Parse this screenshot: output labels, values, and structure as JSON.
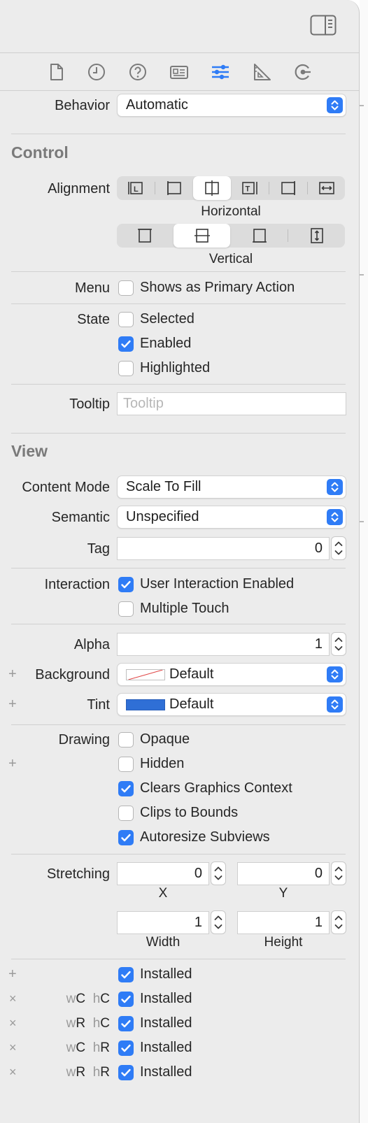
{
  "tabs": [
    {
      "name": "file-inspector",
      "icon": "document-icon",
      "active": false
    },
    {
      "name": "history-inspector",
      "icon": "clock-icon",
      "active": false
    },
    {
      "name": "quick-help",
      "icon": "question-icon",
      "active": false
    },
    {
      "name": "identity-inspector",
      "icon": "id-card-icon",
      "active": false
    },
    {
      "name": "attributes-inspector",
      "icon": "sliders-icon",
      "active": true
    },
    {
      "name": "size-inspector",
      "icon": "ruler-icon",
      "active": false
    },
    {
      "name": "connections-inspector",
      "icon": "arrow-circle-icon",
      "active": false
    }
  ],
  "accent_color": "#2F7CF6",
  "behavior": {
    "label": "Behavior",
    "value": "Automatic"
  },
  "control": {
    "title": "Control",
    "alignment_label": "Alignment",
    "horizontal_caption": "Horizontal",
    "vertical_caption": "Vertical",
    "horizontal_selected_index": 2,
    "vertical_selected_index": 1,
    "menu_label": "Menu",
    "menu_option": "Shows as Primary Action",
    "state_label": "State",
    "state_selected": "Selected",
    "state_enabled": "Enabled",
    "state_highlighted": "Highlighted",
    "tooltip_label": "Tooltip",
    "tooltip_placeholder": "Tooltip"
  },
  "view": {
    "title": "View",
    "content_mode_label": "Content Mode",
    "content_mode_value": "Scale To Fill",
    "semantic_label": "Semantic",
    "semantic_value": "Unspecified",
    "tag_label": "Tag",
    "tag_value": "0",
    "interaction_label": "Interaction",
    "user_interaction": "User Interaction Enabled",
    "multiple_touch": "Multiple Touch",
    "alpha_label": "Alpha",
    "alpha_value": "1",
    "background_label": "Background",
    "background_value": "Default",
    "tint_label": "Tint",
    "tint_value": "Default",
    "tint_color": "#2F6FD6",
    "drawing_label": "Drawing",
    "opaque": "Opaque",
    "hidden": "Hidden",
    "clears_graphics": "Clears Graphics Context",
    "clips_bounds": "Clips to Bounds",
    "autoresize": "Autoresize Subviews",
    "stretching_label": "Stretching",
    "stretch_x": "0",
    "stretch_y": "0",
    "stretch_width": "1",
    "stretch_height": "1",
    "x_caption": "X",
    "y_caption": "Y",
    "width_caption": "Width",
    "height_caption": "Height"
  },
  "installed": {
    "label": "Installed",
    "rows": [
      {
        "action": "+",
        "w": "",
        "wv": "",
        "h": "",
        "hv": ""
      },
      {
        "action": "×",
        "w": "w",
        "wv": "C",
        "h": "h",
        "hv": "C"
      },
      {
        "action": "×",
        "w": "w",
        "wv": "R",
        "h": "h",
        "hv": "C"
      },
      {
        "action": "×",
        "w": "w",
        "wv": "C",
        "h": "h",
        "hv": "R"
      },
      {
        "action": "×",
        "w": "w",
        "wv": "R",
        "h": "h",
        "hv": "R"
      }
    ]
  }
}
